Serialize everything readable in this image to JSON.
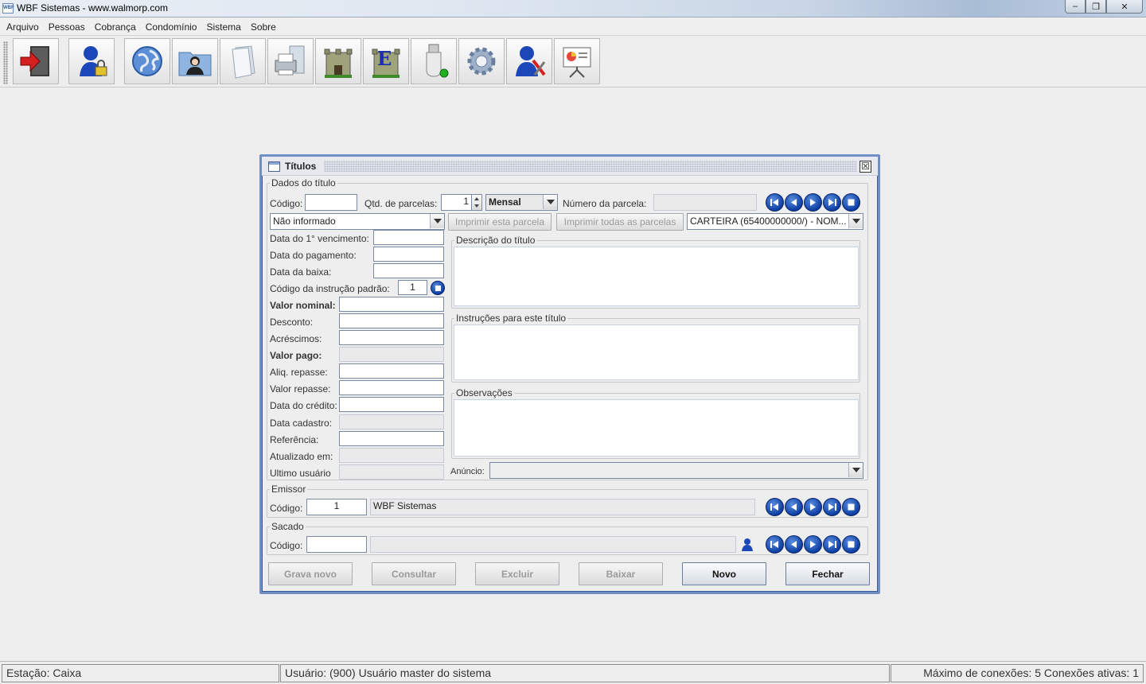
{
  "window": {
    "title": "WBF Sistemas - www.walmorp.com",
    "app_icon_text": "WBF",
    "minimize": "–",
    "restore": "❐",
    "close": "✕"
  },
  "menu": [
    "Arquivo",
    "Pessoas",
    "Cobrança",
    "Condomínio",
    "Sistema",
    "Sobre"
  ],
  "toolbar": {
    "icons": [
      "exit-icon",
      "user-lock-icon",
      "globe-icon",
      "contacts-folder-icon",
      "document-icon",
      "printer-icon",
      "castle-icon",
      "castle-e-icon",
      "usb-icon",
      "gear-icon",
      "user-tools-icon",
      "presentation-icon"
    ]
  },
  "frame": {
    "title": "Títulos",
    "close": "☒",
    "dados": {
      "group_label": "Dados do título",
      "codigo_label": "Código:",
      "codigo_value": "",
      "qtd_label": "Qtd. de parcelas:",
      "qtd_value": "1",
      "periodicidade": "Mensal",
      "numero_parcela_label": "Número da parcela:",
      "numero_parcela_value": "",
      "situacao": "Não informado",
      "btn_imprimir_esta": "Imprimir esta parcela",
      "btn_imprimir_todas": "Imprimir todas as parcelas",
      "carteira": "CARTEIRA (65400000000/) - NOM...",
      "fields": [
        {
          "label": "Data do 1° vencimento:",
          "value": "",
          "bold": false,
          "disabled": false
        },
        {
          "label": "Data do pagamento:",
          "value": "",
          "bold": false,
          "disabled": false
        },
        {
          "label": "Data da baixa:",
          "value": "",
          "bold": false,
          "disabled": false
        },
        {
          "label": "Código da instrução padrão:",
          "value": "1",
          "bold": false,
          "disabled": false
        },
        {
          "label": "Valor nominal:",
          "value": "",
          "bold": true,
          "disabled": false
        },
        {
          "label": "Desconto:",
          "value": "",
          "bold": false,
          "disabled": false
        },
        {
          "label": "Acréscimos:",
          "value": "",
          "bold": false,
          "disabled": false
        },
        {
          "label": "Valor pago:",
          "value": "",
          "bold": true,
          "disabled": true
        },
        {
          "label": "Aliq. repasse:",
          "value": "",
          "bold": false,
          "disabled": false
        },
        {
          "label": "Valor repasse:",
          "value": "",
          "bold": false,
          "disabled": false
        },
        {
          "label": "Data do crédito:",
          "value": "",
          "bold": false,
          "disabled": false
        },
        {
          "label": "Data cadastro:",
          "value": "",
          "bold": false,
          "disabled": true
        },
        {
          "label": "Referência:",
          "value": "",
          "bold": false,
          "disabled": false
        },
        {
          "label": "Atualizado em:",
          "value": "",
          "bold": false,
          "disabled": true
        },
        {
          "label": "Ultimo usuário",
          "value": "",
          "bold": false,
          "disabled": true
        }
      ],
      "descricao_label": "Descrição do título",
      "instrucoes_label": "Instruções para este título",
      "observacoes_label": "Observações",
      "anuncio_label": "Anúncio:",
      "anuncio_value": ""
    },
    "emissor": {
      "group_label": "Emissor",
      "codigo_label": "Código:",
      "codigo_value": "1",
      "nome_value": "WBF Sistemas"
    },
    "sacado": {
      "group_label": "Sacado",
      "codigo_label": "Código:",
      "codigo_value": "",
      "nome_value": ""
    },
    "buttons": {
      "grava_novo": "Grava novo",
      "consultar": "Consultar",
      "excluir": "Excluir",
      "baixar": "Baixar",
      "novo": "Novo",
      "fechar": "Fechar"
    }
  },
  "status": {
    "estacao": "Estação: Caixa",
    "usuario": "Usuário: (900) Usuário master do sistema",
    "conexoes": "Máximo de conexões: 5 Conexões ativas: 1"
  }
}
